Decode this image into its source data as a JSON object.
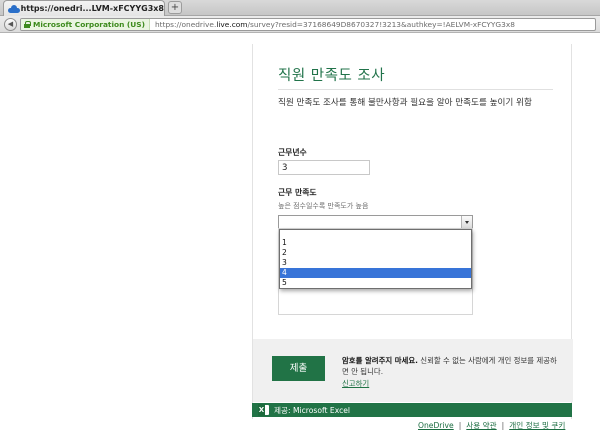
{
  "browser": {
    "tab_title": "https://onedri...LVM-xFCYYG3x8",
    "new_tab_label": "+",
    "back_label": "◀",
    "identity": "Microsoft Corporation (US)",
    "url_prefix": "https://onedrive.",
    "url_domain": "live.com",
    "url_rest": "/survey?resid=37168649D8670327!3213&authkey=!AELVM-xFCYYG3x8"
  },
  "form": {
    "title": "직원 만족도 조사",
    "description": "직원 만족도 조사를 통해 불만사항과 필요을 알아 만족도를 높이기 위함",
    "q1": {
      "label": "근무년수",
      "value": "3"
    },
    "q2": {
      "label": "근무 만족도",
      "hint": "높은 점수일수록 만족도가 높음",
      "selected": "",
      "options": [
        "1",
        "2",
        "3",
        "4",
        "5"
      ],
      "highlighted_option": "4"
    },
    "submit_label": "제출",
    "warning_bold": "암호를 알려주지 마세요.",
    "warning_rest": " 신뢰할 수 없는 사람에게 개인 정보를 제공하면 안 됩니다.",
    "report_link": "신고하기"
  },
  "footer": {
    "provider": "제공: Microsoft Excel",
    "links": [
      "OneDrive",
      "사용 약관",
      "개인 정보 및 쿠키"
    ]
  },
  "colors": {
    "accent": "#217346",
    "selection": "#3874d8"
  }
}
